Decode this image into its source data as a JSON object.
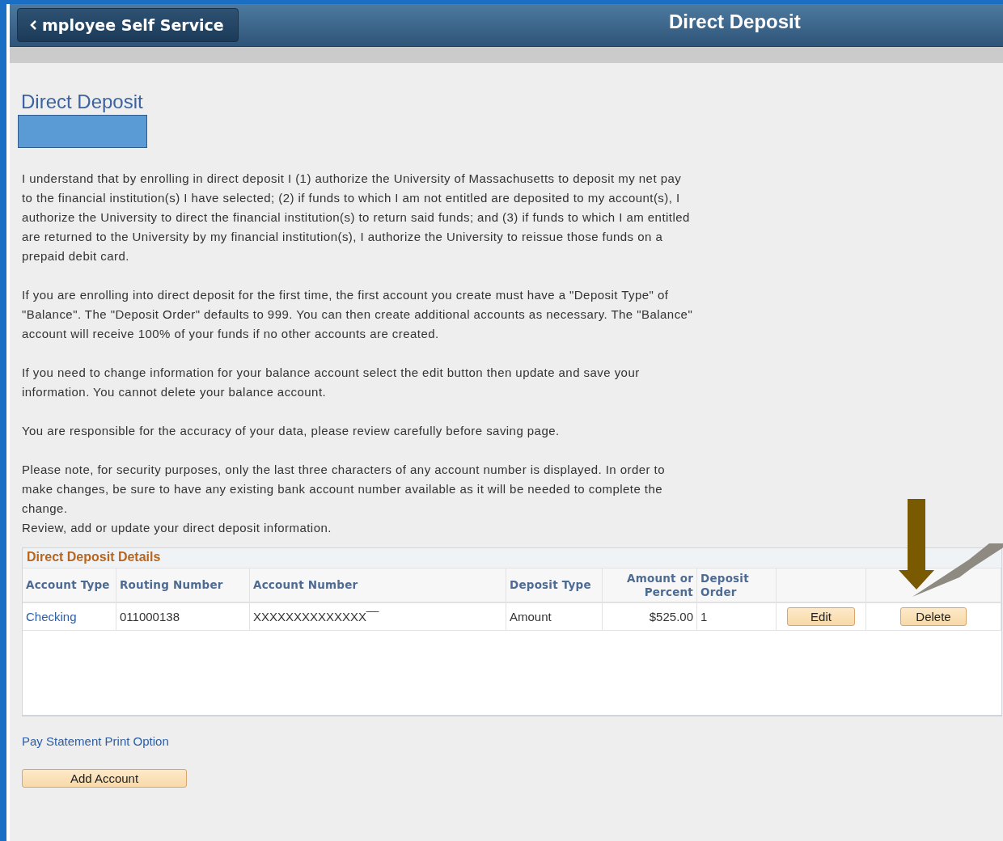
{
  "header": {
    "back_button": "mployee Self Service",
    "title": "Direct Deposit"
  },
  "page_title": "Direct Deposit",
  "instructions": [
    "I understand that by enrolling in direct deposit I (1) authorize the University of Massachusetts to deposit my net pay to the financial institution(s) I have selected; (2) if funds to which I am not entitled are deposited to my account(s), I authorize the University to direct the financial institution(s) to return said funds; and (3) if funds to which I am entitled are returned to the University by my financial institution(s), I authorize the University to reissue those funds on a prepaid debit card.",
    "If you are enrolling into direct deposit for the first time, the first account you create must have a \"Deposit Type\" of \"Balance\". The \"Deposit Order\" defaults to 999. You can then create additional accounts as necessary. The \"Balance\" account will receive 100% of your funds if no other accounts are created.",
    "If you need to change information for your balance account select the edit button then update and save your information. You cannot delete your balance account.",
    "You are responsible for the accuracy of your data, please review carefully before saving page.",
    "Please note, for security purposes, only the last three characters of any account number is displayed. In order to make changes, be sure to have any existing bank account number available as it will be needed to complete the change."
  ],
  "review_note": "Review, add or update your direct deposit information.",
  "table": {
    "title": "Direct Deposit Details",
    "columns": [
      "Account Type",
      "Routing Number",
      "Account Number",
      "Deposit Type",
      "Amount or Percent",
      "Deposit Order"
    ],
    "rows": [
      {
        "cells": [
          "Checking",
          "011000138",
          "XXXXXXXXXXXXXX‾‾‾",
          "Amount",
          "$525.00",
          "1"
        ],
        "buttons": [
          "Edit",
          "Delete"
        ]
      }
    ]
  },
  "link": "Pay Statement Print Option",
  "add_button": "Add Account"
}
